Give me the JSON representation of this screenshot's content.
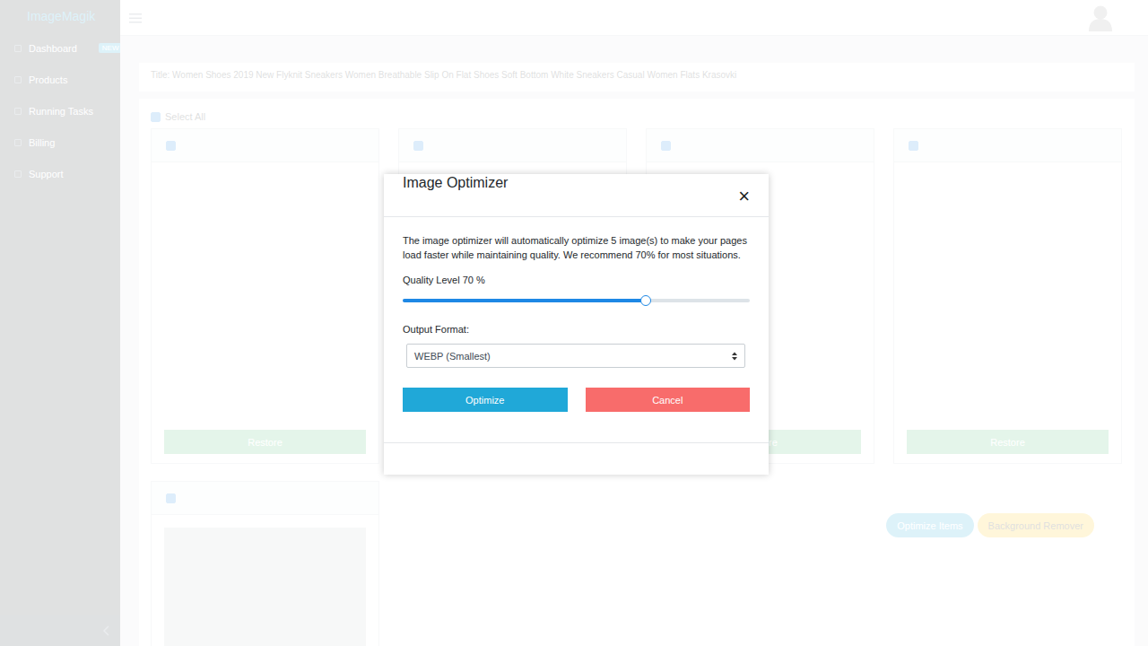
{
  "app": {
    "brand": "ImageMagik"
  },
  "sidebar": {
    "items": [
      {
        "label": "Dashboard",
        "badge": "NEW"
      },
      {
        "label": "Products"
      },
      {
        "label": "Running Tasks"
      },
      {
        "label": "Billing"
      },
      {
        "label": "Support"
      }
    ]
  },
  "page": {
    "title": "Title: Women Shoes 2019 New Flyknit Sneakers Women Breathable Slip On Flat Shoes Soft Bottom White Sneakers Casual Women Flats Krasovki",
    "select_all": {
      "label": "Select All",
      "checked": true
    }
  },
  "cards": [
    {
      "checked": true,
      "button": "Restore"
    },
    {
      "checked": true,
      "button": "Restore"
    },
    {
      "checked": true,
      "button": "Restore"
    },
    {
      "checked": true,
      "button": "Restore"
    },
    {
      "checked": true
    }
  ],
  "actions": [
    "Optimize Items",
    "Background Remover"
  ],
  "modal": {
    "title": "Image Optimizer",
    "close": "×",
    "description": "The image optimizer will automatically optimize 5 image(s) to make your pages load faster while maintaining quality. We recommend 70% for most situations.",
    "quality": {
      "label": "Quality Level 70 %",
      "level": 0.7
    },
    "format": {
      "label": "Output Format:",
      "value": "WEBP (Smallest)"
    },
    "buttons": [
      {
        "label": "Optimize",
        "kind": "primary"
      },
      {
        "label": "Cancel",
        "kind": "danger"
      }
    ]
  }
}
